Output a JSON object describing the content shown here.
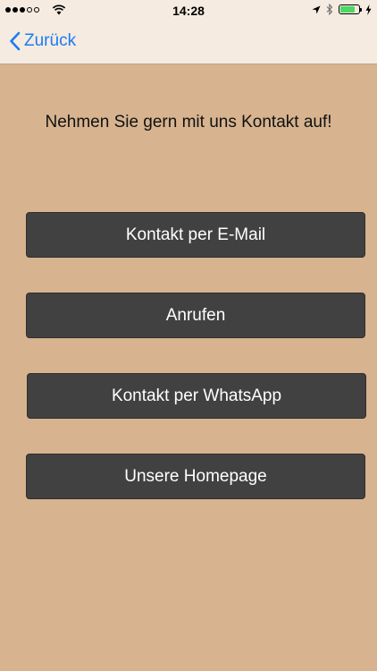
{
  "status_bar": {
    "time": "14:28",
    "signal_dots_filled": 3,
    "signal_dots_total": 5,
    "battery_level": 0.8,
    "battery_color": "#4cd964",
    "icons": [
      "signal-dots-icon",
      "wifi-icon",
      "location-arrow-icon",
      "bluetooth-icon",
      "battery-icon",
      "charging-bolt-icon"
    ]
  },
  "nav": {
    "back_label": "Zurück",
    "back_icon": "chevron-left-icon",
    "accent_color": "#1a7cf2"
  },
  "main": {
    "headline": "Nehmen Sie gern mit uns Kontakt auf!",
    "buttons": [
      {
        "label": "Kontakt per E-Mail"
      },
      {
        "label": "Anrufen"
      },
      {
        "label": "Kontakt per WhatsApp"
      },
      {
        "label": "Unsere Homepage"
      }
    ]
  },
  "colors": {
    "background": "#d7b48f",
    "bar_background": "#f5ebe0",
    "button_background": "#414141",
    "button_text": "#ffffff"
  }
}
